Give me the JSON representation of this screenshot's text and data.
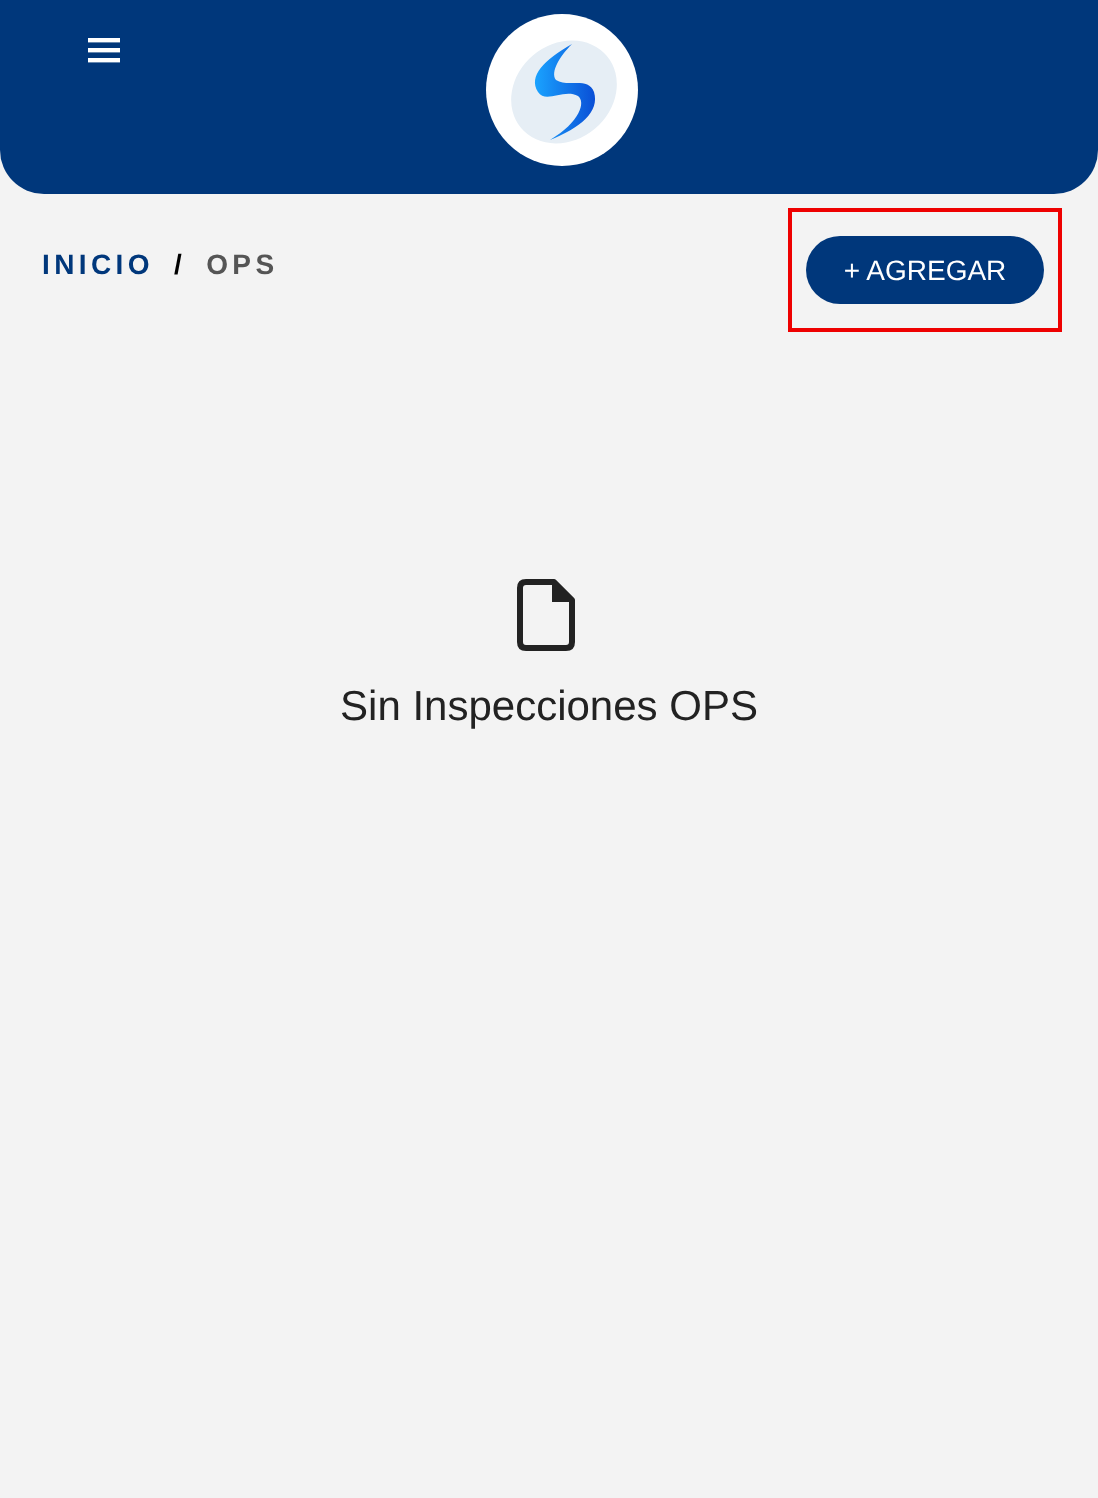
{
  "breadcrumb": [
    {
      "label": "INICIO",
      "kind": "link"
    },
    {
      "label": "/",
      "kind": "separator"
    },
    {
      "label": "OPS",
      "kind": "current"
    }
  ],
  "add_button": {
    "label": "+ AGREGAR",
    "highlighted": true
  },
  "empty_state": {
    "message": "Sin Inspecciones OPS"
  }
}
